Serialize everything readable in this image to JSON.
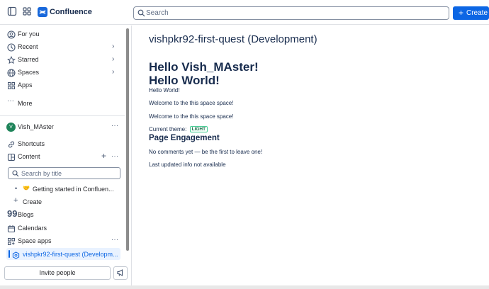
{
  "app": {
    "name": "Confluence"
  },
  "topbar": {
    "search_placeholder": "Search",
    "create_label": "Create"
  },
  "sidebar": {
    "nav": [
      {
        "label": "For you",
        "icon": "user-circle-icon"
      },
      {
        "label": "Recent",
        "icon": "clock-icon"
      },
      {
        "label": "Starred",
        "icon": "star-icon"
      },
      {
        "label": "Spaces",
        "icon": "globe-icon"
      },
      {
        "label": "Apps",
        "icon": "apps-grid-icon"
      },
      {
        "label": "More",
        "icon": "more-dots-icon"
      }
    ],
    "user": {
      "name": "Vish_MAster",
      "initial": "V"
    },
    "space_items": [
      {
        "label": "Shortcuts"
      },
      {
        "label": "Content"
      }
    ],
    "search_placeholder": "Search by title",
    "tree": [
      {
        "label": "Getting started in Confluen...",
        "emoji": "🤝"
      },
      {
        "label": "Create"
      }
    ],
    "bottom_items": [
      {
        "label": "Blogs"
      },
      {
        "label": "Calendars"
      },
      {
        "label": "Space apps"
      },
      {
        "label": "vishpkr92-first-quest (Developm..."
      }
    ],
    "invite_label": "Invite people"
  },
  "main": {
    "title": "vishpkr92-first-quest (Development)",
    "heading1": "Hello Vish_MAster!",
    "heading2": "Hello World!",
    "para1": "Hello World!",
    "para2": "Welcome to the this space space!",
    "para3": "Welcome to the this space space!",
    "theme_label": "Current theme:",
    "theme_value": "LIGHT",
    "engagement_heading": "Page Engagement",
    "comments_text": "No comments yet — be the first to leave one!",
    "updated_text": "Last updated info not available"
  },
  "colors": {
    "accent": "#0c66e4",
    "avatar": "#1f845a"
  }
}
